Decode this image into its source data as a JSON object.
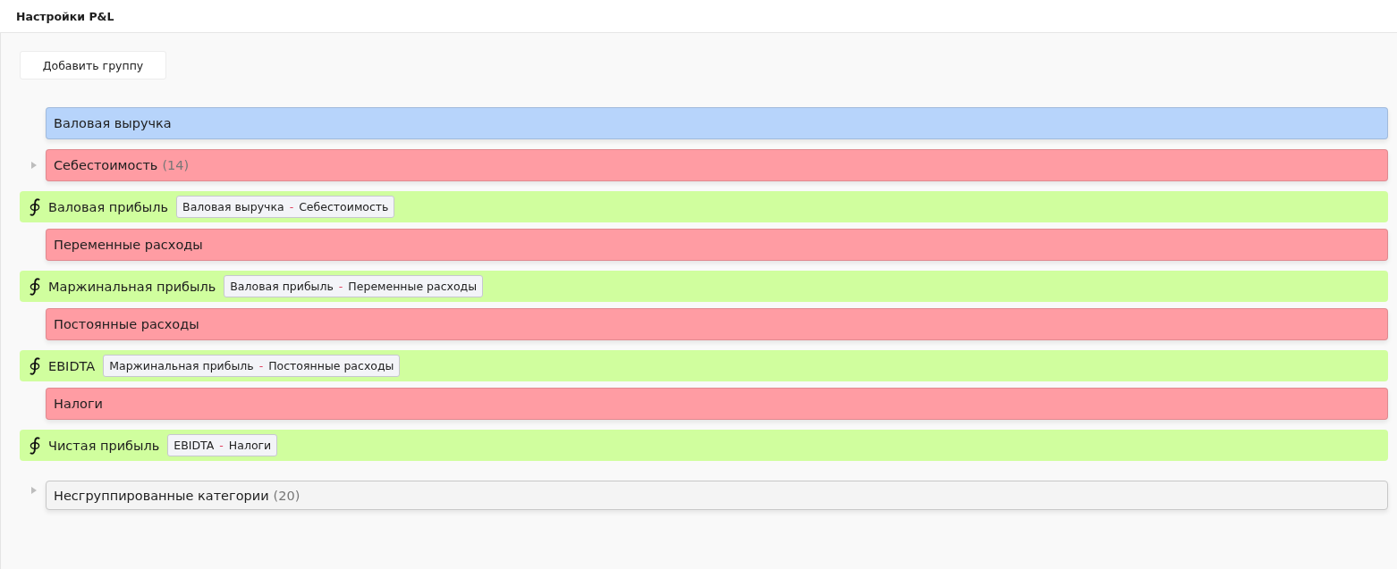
{
  "header": {
    "title": "Настройки P&L"
  },
  "toolbar": {
    "add_group_button": "Добавить группу"
  },
  "rows": [
    {
      "kind": "group",
      "name": "Валовая выручка",
      "color": "#b7d4fb"
    },
    {
      "kind": "group",
      "name": "Себестоимость",
      "count": "(14)",
      "color": "#ff9ca3",
      "expanded": false
    },
    {
      "kind": "formula",
      "name": "Валовая прибыль",
      "formula": {
        "left": "Валовая выручка",
        "operator": "-",
        "right": "Себестоимость"
      }
    },
    {
      "kind": "group",
      "name": "Переменные расходы",
      "color": "#ff9ca3"
    },
    {
      "kind": "formula",
      "name": "Маржинальная прибыль",
      "formula": {
        "left": "Валовая прибыль",
        "operator": "-",
        "right": "Переменные расходы"
      }
    },
    {
      "kind": "group",
      "name": "Постоянные расходы",
      "color": "#ff9ca3"
    },
    {
      "kind": "formula",
      "name": "EBIDTA",
      "formula": {
        "left": "Маржинальная прибыль",
        "operator": "-",
        "right": "Постоянные расходы"
      }
    },
    {
      "kind": "group",
      "name": "Налоги",
      "color": "#ff9ca3"
    },
    {
      "kind": "formula",
      "name": "Чистая прибыль",
      "formula": {
        "left": "EBIDTA",
        "operator": "-",
        "right": "Налоги"
      }
    },
    {
      "kind": "ungrouped",
      "name": "Несгруппированные категории",
      "count": "(20)",
      "expanded": false
    }
  ]
}
